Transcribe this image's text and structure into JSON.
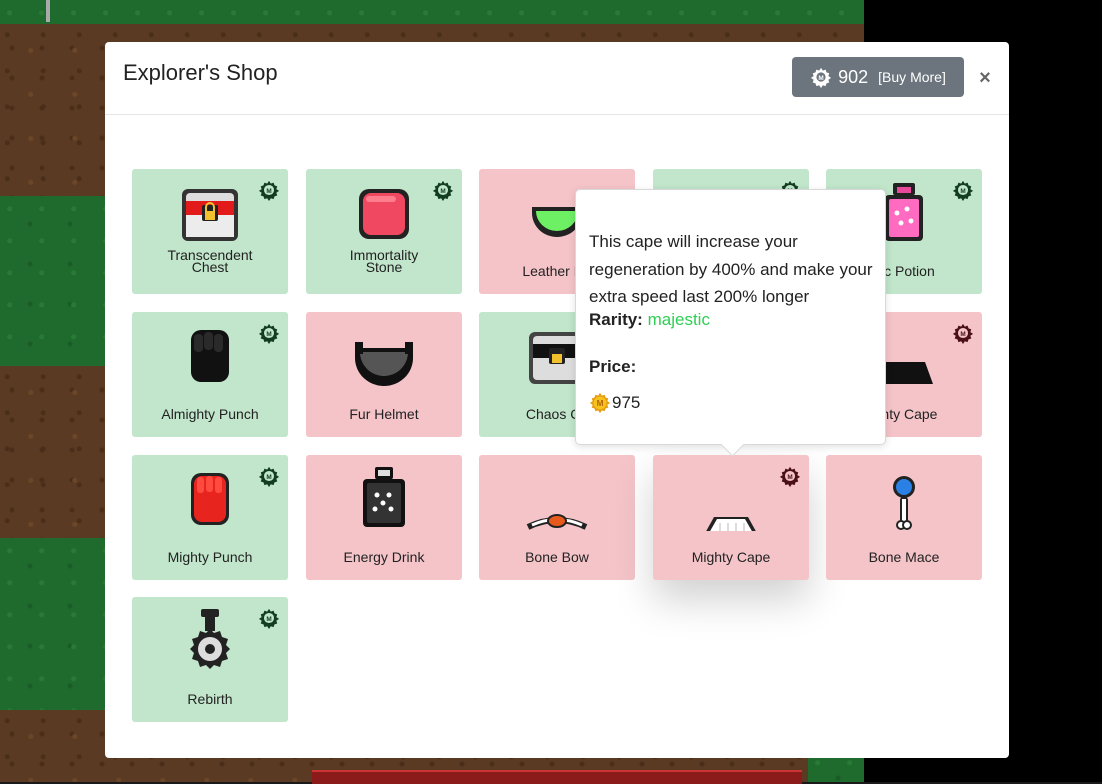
{
  "modal": {
    "title": "Explorer's Shop",
    "currency_amount": "902",
    "buy_more_label": "[Buy More]",
    "close_label": "×"
  },
  "items": [
    {
      "name": "Transcendent Chest",
      "line1": "Transcendent",
      "line2": "Chest",
      "color": "green"
    },
    {
      "name": "Immortality Stone",
      "line1": "Immortality",
      "line2": "Stone",
      "color": "green"
    },
    {
      "name": "Leather Helmet",
      "label_visible": "Leather He",
      "color": "red"
    },
    {
      "name": "hidden-item-row1-col4",
      "color": "green"
    },
    {
      "name": "Mythic Potion",
      "label_visible": "hic Potion",
      "color": "green"
    },
    {
      "name": "Almighty Punch",
      "label": "Almighty Punch",
      "color": "green"
    },
    {
      "name": "Fur Helmet",
      "label": "Fur Helmet",
      "color": "red"
    },
    {
      "name": "Chaos Chest",
      "label_visible": "Chaos Ch",
      "color": "green"
    },
    {
      "name": "hidden-item-row2-col4",
      "color": "green"
    },
    {
      "name": "Almighty Cape",
      "label_visible": "ighty Cape",
      "color": "red"
    },
    {
      "name": "Mighty Punch",
      "label": "Mighty Punch",
      "color": "green"
    },
    {
      "name": "Energy Drink",
      "label": "Energy Drink",
      "color": "red"
    },
    {
      "name": "Bone Bow",
      "label": "Bone Bow",
      "color": "red"
    },
    {
      "name": "Mighty Cape",
      "label": "Mighty Cape",
      "color": "red"
    },
    {
      "name": "Bone Mace",
      "label": "Bone Mace",
      "color": "red"
    },
    {
      "name": "Rebirth",
      "label": "Rebirth",
      "color": "green"
    }
  ],
  "tooltip": {
    "description": "This cape will increase your regeneration by 400% and make your extra speed last 200% longer",
    "rarity_label": "Rarity:",
    "rarity_value": "majestic",
    "price_label": "Price:",
    "price_value": "975"
  },
  "colors": {
    "tile_green": "#c1e6cb",
    "tile_red": "#f4c4c9",
    "rarity_majestic": "#2fcf55",
    "button_gray": "#6c757d"
  },
  "icons": {
    "currency": "gear-badge-icon",
    "price_coin": "gold-coin-icon"
  }
}
